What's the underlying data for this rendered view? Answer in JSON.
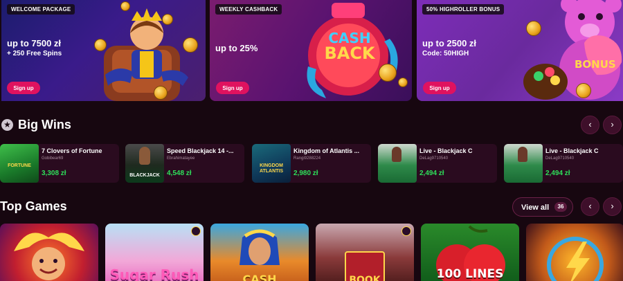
{
  "promos": [
    {
      "tag": "WELCOME PACKAGE",
      "amount": "up to 7500 zł",
      "sub": "+ 250 Free Spins",
      "button": "Sign up"
    },
    {
      "tag": "WEEKLY CASHBACK",
      "amount": "up to 25%",
      "sub": "",
      "button": "Sign up",
      "art_text_1": "CASH",
      "art_text_2": "BACK"
    },
    {
      "tag": "50% HIGHROLLER BONUS",
      "amount": "up to 2500 zł",
      "sub": "Code: 50HIGH",
      "button": "Sign up",
      "art_text": "BONUS"
    }
  ],
  "big_wins": {
    "title": "Big Wins",
    "items": [
      {
        "game": "7 Clovers of Fortune",
        "user": "Gobibear69",
        "amount": "3,308 zł",
        "thumb_text": "FORTUNE"
      },
      {
        "game": "Speed Blackjack 14 -...",
        "user": "Ebrahimatayee",
        "amount": "4,548 zł",
        "thumb_text": "BLACKJACK"
      },
      {
        "game": "Kingdom of Atlantis ...",
        "user": "Rangi9288224",
        "amount": "2,980 zł",
        "thumb_text": "KINGDOM ATLANTIS"
      },
      {
        "game": "Live - Blackjack C",
        "user": "DeLag9710540",
        "amount": "2,494 zł"
      },
      {
        "game": "Live - Blackjack C",
        "user": "DeLag9710540",
        "amount": "2,494 zł"
      }
    ]
  },
  "top_games": {
    "title": "Top Games",
    "view_all": "View all",
    "count": "36",
    "tiles": [
      {
        "label": ""
      },
      {
        "label": "Sugar Rush"
      },
      {
        "label": "CASH"
      },
      {
        "label": "BOOK"
      },
      {
        "label": "100 LINES"
      },
      {
        "label": ""
      }
    ]
  },
  "icons": {
    "star": "★",
    "prev": "‹",
    "next": "›"
  },
  "colors": {
    "accent": "#e0125f",
    "win_green": "#2ee05a",
    "background": "#170710"
  }
}
